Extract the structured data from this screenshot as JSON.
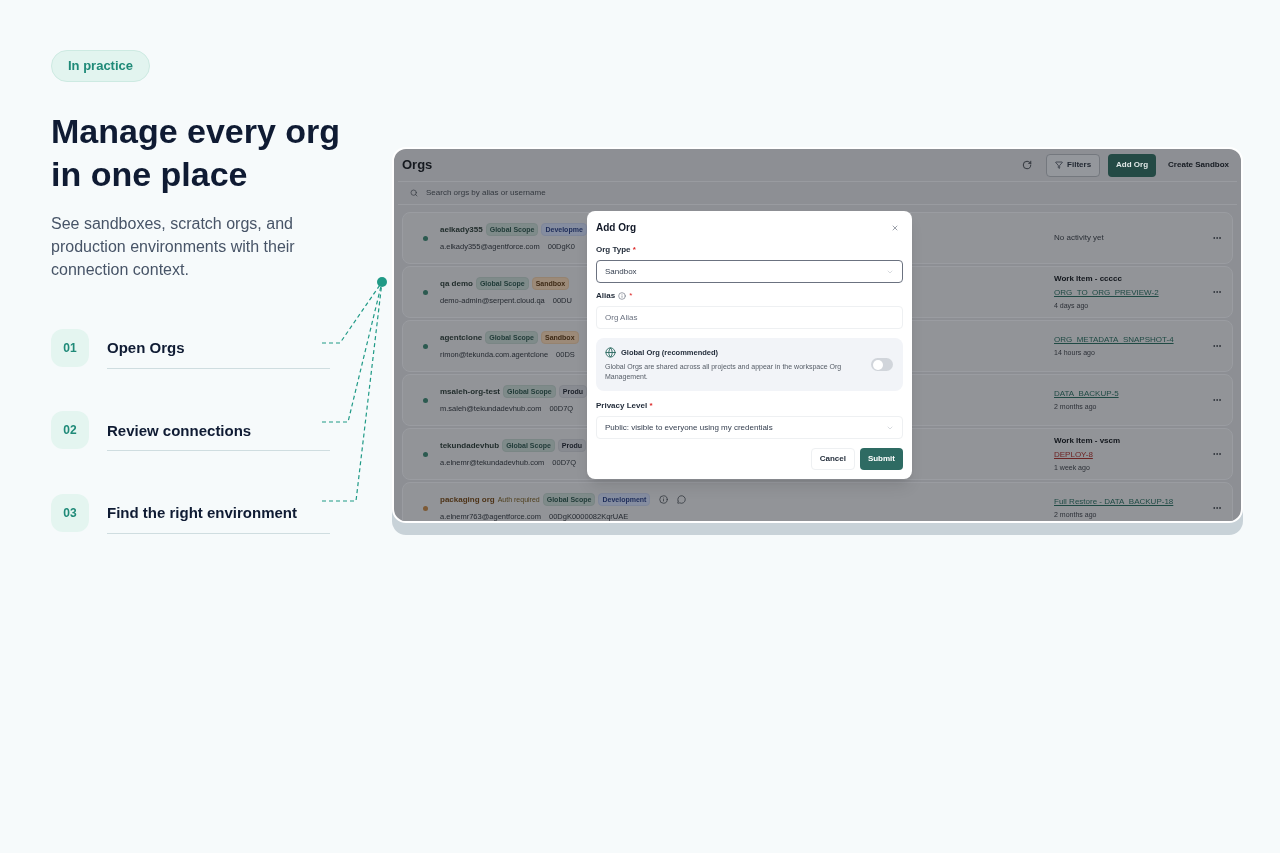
{
  "intro": {
    "badge": "In practice",
    "heading_lines": [
      "Manage every org",
      "in one place"
    ],
    "text": "See sandboxes, scratch orgs, and production environments with their connection context."
  },
  "steps": [
    {
      "number": "01",
      "label": "Open Orgs"
    },
    {
      "number": "02",
      "label": "Review connections"
    },
    {
      "number": "03",
      "label": "Find the right environment"
    }
  ],
  "app": {
    "title": "Orgs",
    "buttons": [
      {
        "label": "Filters",
        "kind": "outline"
      },
      {
        "label": "Add Org",
        "kind": "primary"
      },
      {
        "label": "Create Sandbox",
        "kind": "plain"
      }
    ],
    "search": {
      "placeholder": "Search orgs by alias or username"
    },
    "orgs": [
      {
        "name": "aelkady355",
        "color": "#2c5a50",
        "badges": [
          {
            "label": "Global Scope",
            "kind": "scope"
          },
          {
            "label": "Developme",
            "kind": "development"
          }
        ],
        "email": "a.elkady355@agentforce.com",
        "org_id": "00DgK0",
        "activity": {
          "note": "No activity yet"
        }
      },
      {
        "name": "qa demo",
        "color": "#2c5a50",
        "badges": [
          {
            "label": "Global Scope",
            "kind": "scope"
          },
          {
            "label": "Sandbox",
            "kind": "sandbox"
          }
        ],
        "email": "demo-admin@serpent.cloud.qa",
        "org_id": "00DU",
        "activity": {
          "title": "Work Item - ccccc",
          "link": "ORG_TO_ORG_PREVIEW-2",
          "link_failed": false,
          "time": "4 days ago"
        }
      },
      {
        "name": "agentclone",
        "color": "#2c5a50",
        "badges": [
          {
            "label": "Global Scope",
            "kind": "scope"
          },
          {
            "label": "Sandbox",
            "kind": "sandbox"
          }
        ],
        "email": "rimon@tekunda.com.agentclone",
        "org_id": "00DS",
        "activity": {
          "link": "ORG_METADATA_SNAPSHOT-4",
          "link_failed": false,
          "time": "14 hours ago"
        }
      },
      {
        "name": "msaleh-org-test",
        "color": "#2c5a50",
        "badges": [
          {
            "label": "Global Scope",
            "kind": "scope"
          },
          {
            "label": "Produ",
            "kind": "production"
          }
        ],
        "email": "m.saleh@tekundadevhub.com",
        "org_id": "00D7Q",
        "activity": {
          "link": "DATA_BACKUP-5",
          "link_failed": false,
          "time": "2 months ago"
        }
      },
      {
        "name": "tekundadevhub",
        "color": "#2c5a50",
        "badges": [
          {
            "label": "Global Scope",
            "kind": "scope"
          },
          {
            "label": "Produ",
            "kind": "production"
          }
        ],
        "email": "a.elnemr@tekundadevhub.com",
        "org_id": "00D7Q",
        "activity": {
          "title": "Work Item - vscm",
          "link": "DEPLOY-8",
          "link_failed": true,
          "time": "1 week ago"
        }
      },
      {
        "name": "packaging org",
        "color": "#7d5a36",
        "auth_note": "Auth required",
        "badges": [
          {
            "label": "Global Scope",
            "kind": "scope"
          },
          {
            "label": "Development",
            "kind": "development"
          }
        ],
        "email": "a.elnemr763@agentforce.com",
        "org_id": "00DgK0000082KqrUAE",
        "activity": {
          "link": "Full Restore - DATA_BACKUP-18",
          "link_failed": false,
          "time": "2 months ago"
        }
      }
    ]
  },
  "modal": {
    "title": "Add Org",
    "org_type": {
      "label": "Org Type",
      "value": "Sandbox",
      "focused": true
    },
    "alias": {
      "label": "Alias",
      "placeholder": "Org Alias"
    },
    "global_org": {
      "title": "Global Org (recommended)",
      "description": "Global Orgs are shared across all projects and appear in the workspace Org Management.",
      "on": false
    },
    "privacy": {
      "label": "Privacy Level",
      "value": "Public: visible to everyone using my credentials",
      "focused": false
    },
    "required_mark": "*",
    "buttons": [
      {
        "label": "Cancel",
        "kind": "secondary"
      },
      {
        "label": "Submit",
        "kind": "primary"
      }
    ]
  }
}
